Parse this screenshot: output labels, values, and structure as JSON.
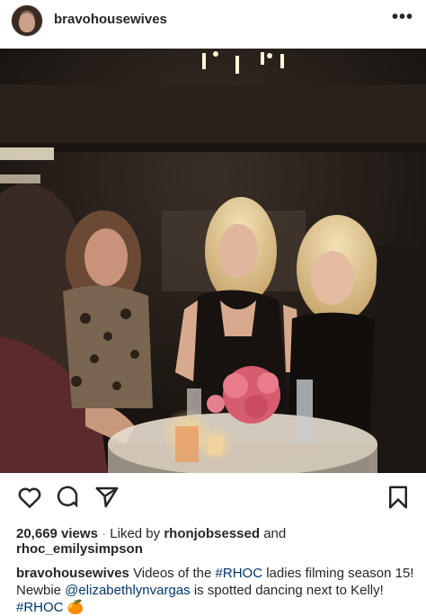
{
  "post": {
    "username": "bravohousewives",
    "more_icon": "more-horizontal-icon"
  },
  "actions": {
    "like_icon": "heart-icon",
    "comment_icon": "comment-icon",
    "share_icon": "send-icon",
    "save_icon": "bookmark-icon"
  },
  "stats": {
    "views": "20,669 views",
    "separator": "·",
    "liked_by_prefix": "Liked by",
    "liked_by_user": "rhonjobsessed",
    "and": "and",
    "liked_by_user2": "rhoc_emilysimpson"
  },
  "caption": {
    "username": "bravohousewives",
    "text1": "Videos of the",
    "hashtag1": "#RHOC",
    "text2": "ladies filming season 15! Newbie",
    "mention": "@elizabethlynvargas",
    "text3": "is spotted dancing next to Kelly!",
    "hashtag2": "#RHOC",
    "emoji": "🍊"
  }
}
